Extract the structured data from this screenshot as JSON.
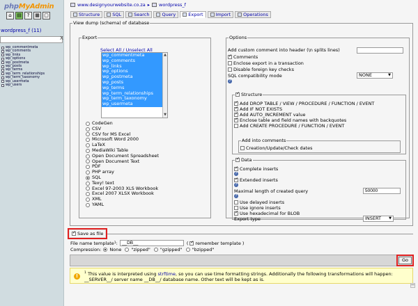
{
  "sidebar": {
    "logo_php": "php",
    "logo_my": "MyAdmin",
    "icons": [
      "⌂",
      "▤",
      "?",
      "▦",
      "▢"
    ],
    "db_title": "wordpress_f (11)",
    "filter_clear": "X",
    "tables": [
      "wp_commentmeta",
      "wp_comments",
      "wp_links",
      "wp_options",
      "wp_postmeta",
      "wp_posts",
      "wp_terms",
      "wp_term_relationships",
      "wp_term_taxonomy",
      "wp_usermeta",
      "wp_users"
    ]
  },
  "breadcrumb": {
    "server": "www.designyourwebsite.co.za",
    "sep": "▸",
    "database": "wordpress_f"
  },
  "tabs": [
    "Structure",
    "SQL",
    "Search",
    "Query",
    "Export",
    "Import",
    "Operations"
  ],
  "main": {
    "legend": "View dump (schema) of database",
    "export": {
      "legend": "Export",
      "select_all": "Select All / Unselect All",
      "tables": [
        "wp_commentmeta",
        "wp_comments",
        "wp_links",
        "wp_options",
        "wp_postmeta",
        "wp_posts",
        "wp_terms",
        "wp_term_relationships",
        "wp_term_taxonomy",
        "wp_usermeta"
      ],
      "formats": [
        "CodeGen",
        "CSV",
        "CSV for MS Excel",
        "Microsoft Word 2000",
        "LaTeX",
        "MediaWiki Table",
        "Open Document Spreadsheet",
        "Open Document Text",
        "PDF",
        "PHP array",
        "SQL",
        "Texy! text",
        "Excel 97-2003 XLS Workbook",
        "Excel 2007 XLSX Workbook",
        "XML",
        "YAML"
      ],
      "selected_format": "SQL"
    },
    "options": {
      "legend": "Options",
      "custom_comment": "Add custom comment into header (\\n splits lines)",
      "comments": "Comments",
      "enclose_transaction": "Enclose export in a transaction",
      "disable_fk": "Disable foreign key checks",
      "sql_compat": "SQL compatibility mode",
      "sql_compat_value": "NONE",
      "help": "?",
      "structure": {
        "legend": "Structure",
        "add_drop": "Add DROP TABLE / VIEW / PROCEDURE / FUNCTION / EVENT",
        "add_if_not_exists": "Add IF NOT EXISTS",
        "add_auto_increment": "Add AUTO_INCREMENT value",
        "enclose_backquotes": "Enclose table and field names with backquotes",
        "add_create": "Add CREATE PROCEDURE / FUNCTION / EVENT",
        "comments_legend": "Add into comments",
        "creation_dates": "Creation/Update/Check dates"
      },
      "data": {
        "legend": "Data",
        "complete_inserts": "Complete inserts",
        "extended_inserts": "Extended inserts",
        "max_length": "Maximal length of created query",
        "max_length_value": "50000",
        "delayed_inserts": "Use delayed inserts",
        "ignore_inserts": "Use ignore inserts",
        "hex_blob": "Use hexadecimal for BLOB",
        "export_type": "Export type",
        "export_type_value": "INSERT"
      }
    }
  },
  "save": {
    "legend": "Save as file",
    "filename_label": "File name template",
    "filename_sup": "1",
    "filename_colon": ":",
    "filename_value": "__DB__",
    "remember_open": "(",
    "remember": "remember template",
    "remember_close": ")",
    "compression_label": "Compression:",
    "compression": [
      "None",
      "\"zipped\"",
      "\"gzipped\"",
      "\"bzipped\""
    ]
  },
  "go_label": "Go",
  "notice": {
    "sup": "1",
    "text_1": " This value is interpreted using ",
    "link": "strftime",
    "text_2": ", so you can use time formatting strings. Additionally the following transformations will happen: __SERVER__/ server name __DB__/ database name. Other text will be kept as is."
  },
  "colors": {
    "selection": "#3399ff",
    "highlight_box": "#e02020",
    "notice_bg": "#ffffcc",
    "sidebar_bg": "#d0dce0"
  }
}
